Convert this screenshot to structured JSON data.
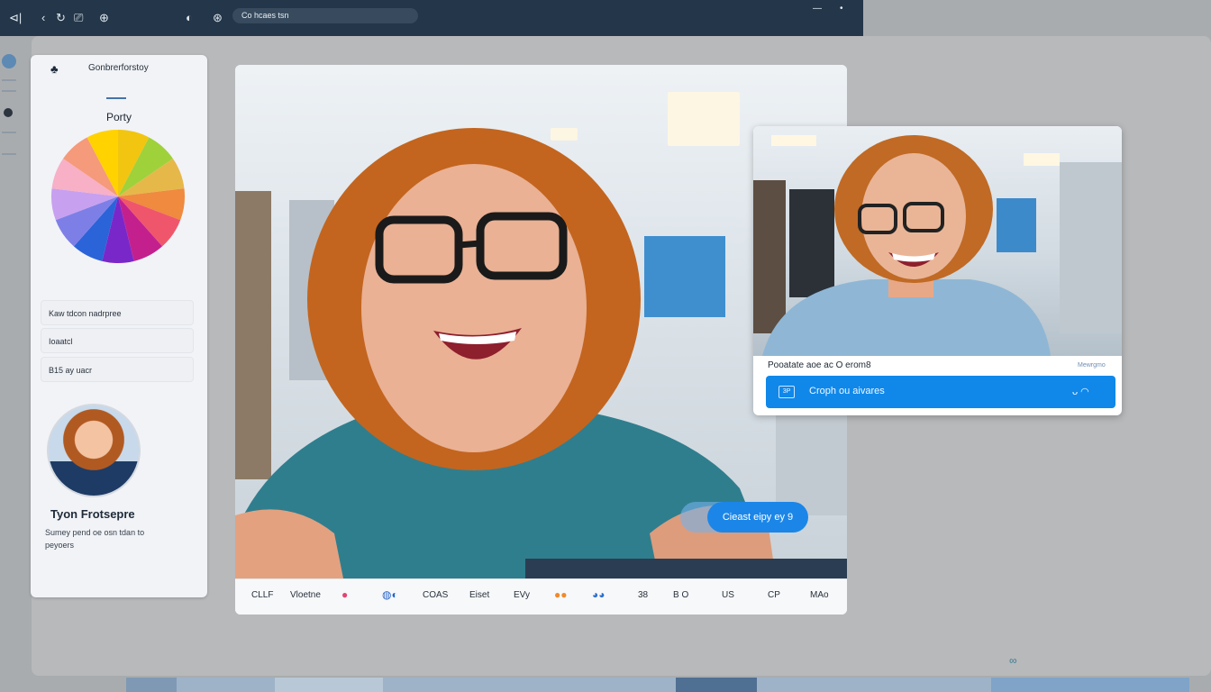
{
  "topbar": {
    "search_text": "Co hcaes tsn",
    "winbtn_min": "—",
    "winbtn_close": "•"
  },
  "sidebar": {
    "title": "Gonbrerforstoy",
    "subtitle": "Porty",
    "pie_colors": [
      "#f2c511",
      "#9fd13b",
      "#e6b84a",
      "#ef8a3e",
      "#f0566b",
      "#c3208e",
      "#7a27c9",
      "#2b63d9",
      "#7e7fe6",
      "#c7a0f0",
      "#f7b0c6",
      "#f59a7a",
      "#ffd200"
    ],
    "items": [
      {
        "label": "Kaw tdcon nadrpree"
      },
      {
        "label": "Ioaatcl"
      },
      {
        "label": "B15 ay uacr"
      }
    ],
    "profile": {
      "name": "Tyon Frotsepre",
      "description": "Sumey pend oe osn tdan to peyoers"
    }
  },
  "video": {
    "bubble_text": "Cieast eipy ey 9",
    "toolbar": [
      {
        "label": "CLLF"
      },
      {
        "label": "Vloetne"
      },
      {
        "label": "●",
        "color": "#e04671"
      },
      {
        "label": "◍◐",
        "color": "#2563c9"
      },
      {
        "label": "COAS"
      },
      {
        "label": "Eiset"
      },
      {
        "label": "EVy"
      },
      {
        "label": "●●",
        "color": "#f08a2a"
      },
      {
        "label": "◕◕",
        "color": "#2b6fd1"
      },
      {
        "label": "38"
      },
      {
        "label": "B O"
      },
      {
        "label": "US"
      },
      {
        "label": "CP"
      },
      {
        "label": "MAo"
      }
    ]
  },
  "popup": {
    "caption": "Pooatate aoe ac O erom8",
    "caption_right": "Mewrgmo",
    "action_label": "Croph ou aivares",
    "action_icon": "3P",
    "action_toggle": "ᴗ ◠"
  },
  "colors": {
    "accent": "#0f88ea",
    "topbar": "#243649"
  }
}
